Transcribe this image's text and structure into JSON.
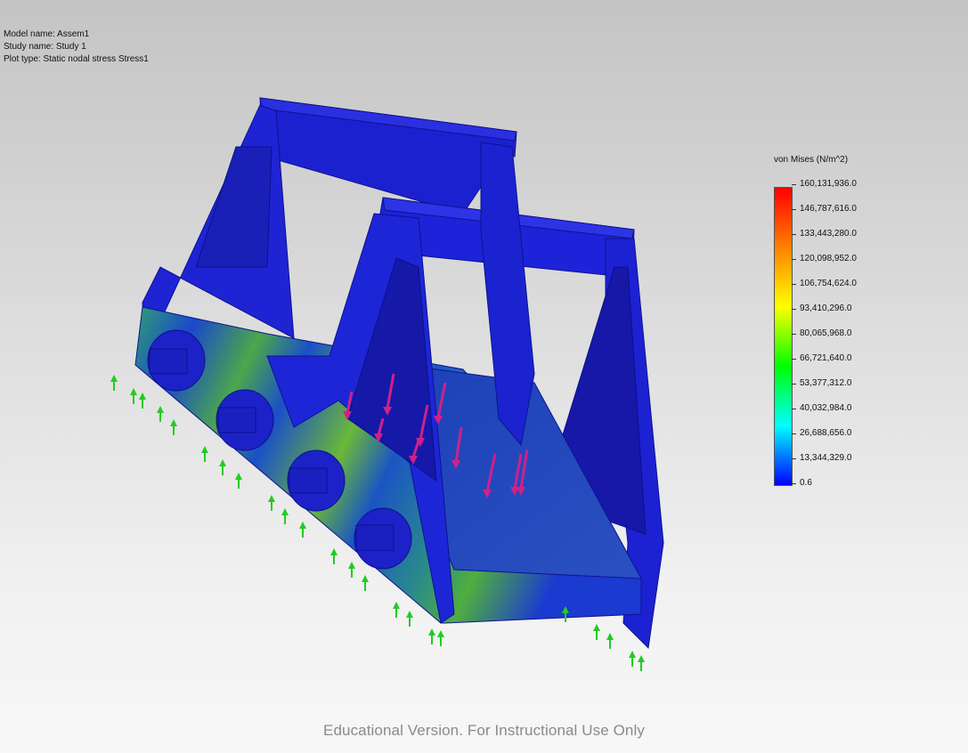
{
  "info": {
    "model_name": "Model name: Assem1",
    "study_name": "Study name: Study 1",
    "plot_type": "Plot type: Static nodal stress Stress1"
  },
  "legend": {
    "title": "von Mises (N/m^2)",
    "ticks": [
      "160,131,936.0",
      "146,787,616.0",
      "133,443,280.0",
      "120,098,952.0",
      "106,754,624.0",
      "93,410,296.0",
      "80,065,968.0",
      "66,721,640.0",
      "53,377,312.0",
      "40,032,984.0",
      "26,688,656.0",
      "13,344,329.0",
      "0.6"
    ],
    "colors": [
      "#ff0000",
      "#ff8000",
      "#ffff00",
      "#00ff00",
      "#00ffff",
      "#0000ff"
    ]
  },
  "model_colors": {
    "frame": "#1d22d6",
    "frame_dark": "#1218a8",
    "stress_low": "#1a3fd0",
    "stress_mid": "#2f9a7a",
    "stress_high": "#7fbf30",
    "fixture_arrow": "#22cc22",
    "load_arrow": "#d0208a"
  },
  "watermark": "Educational Version. For Instructional Use Only"
}
